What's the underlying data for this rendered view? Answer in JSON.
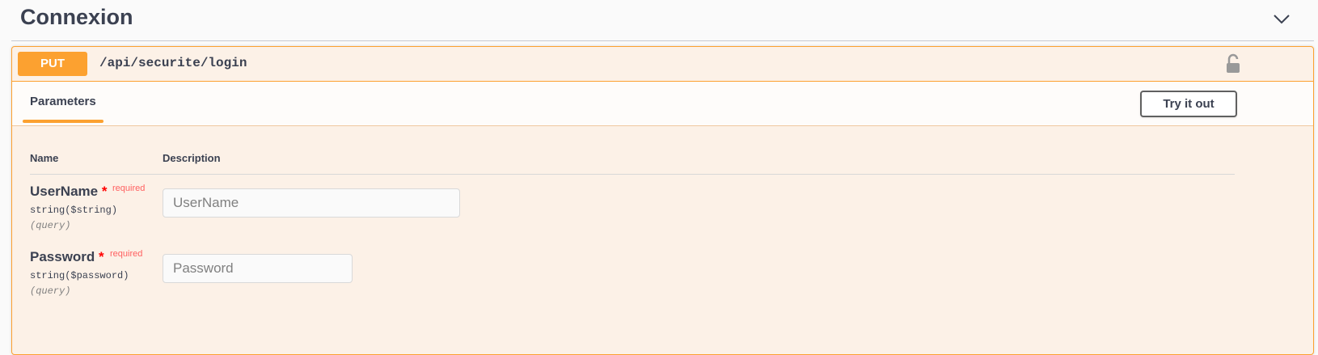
{
  "section": {
    "title": "Connexion"
  },
  "operation": {
    "method": "PUT",
    "path": "/api/securite/login",
    "method_color": "#fca130"
  },
  "tabs": {
    "parameters": "Parameters",
    "try_it_out": "Try it out"
  },
  "table": {
    "col_name": "Name",
    "col_description": "Description"
  },
  "parameters": [
    {
      "name": "UserName",
      "required_star": "*",
      "required_label": "required",
      "type": "string($string)",
      "in": "(query)",
      "placeholder": "UserName"
    },
    {
      "name": "Password",
      "required_star": "*",
      "required_label": "required",
      "type": "string($password)",
      "in": "(query)",
      "placeholder": "Password"
    }
  ],
  "icons": {
    "collapse": "chevron-down-icon",
    "lock": "lock-icon"
  }
}
